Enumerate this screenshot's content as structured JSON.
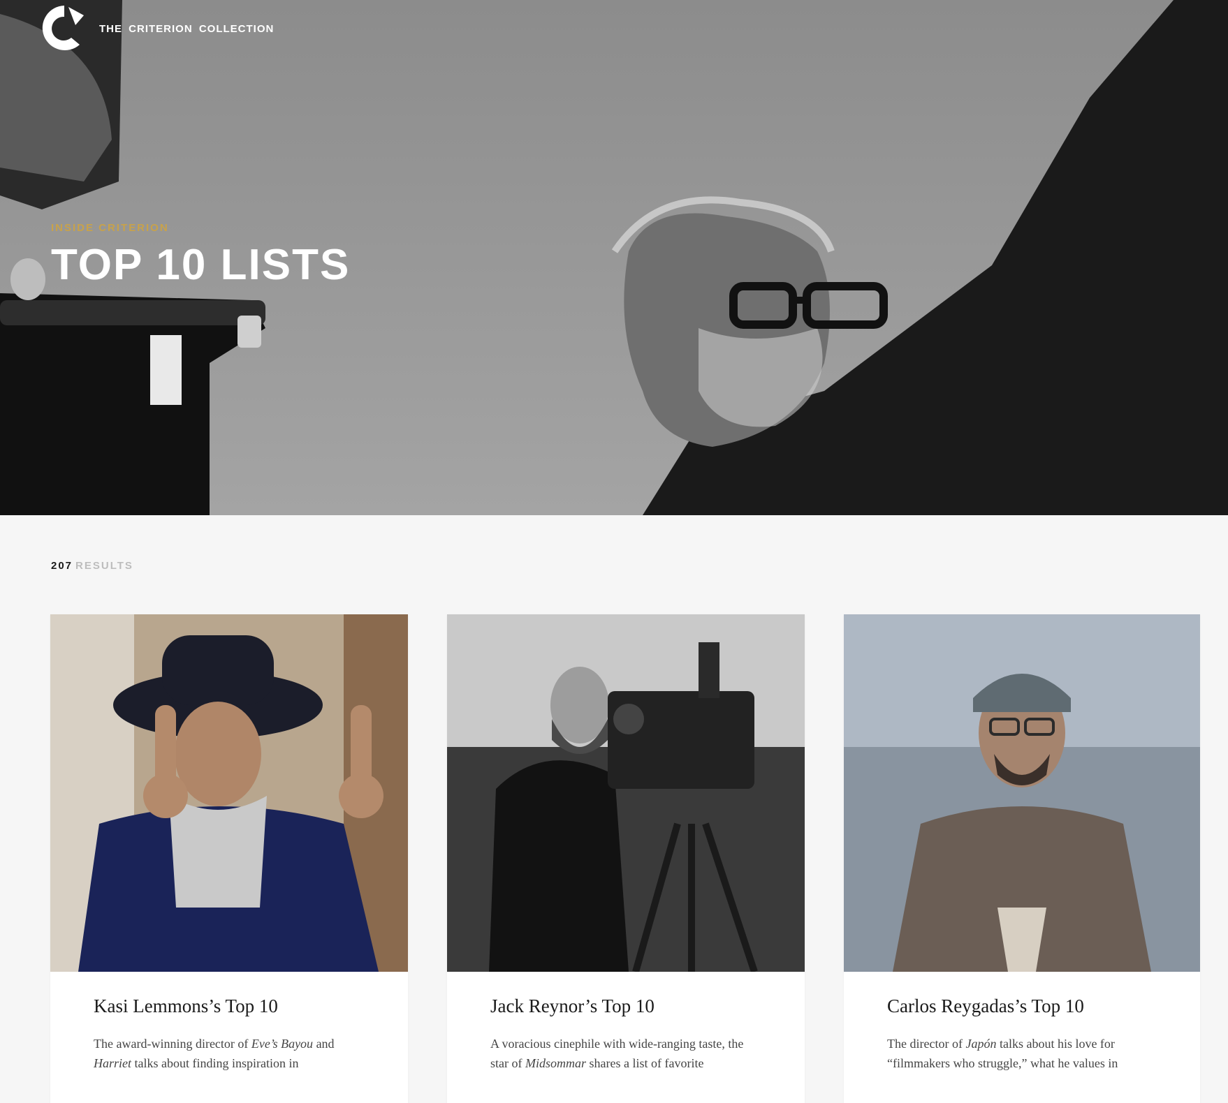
{
  "header": {
    "brand": "THE CRITERION COLLECTION"
  },
  "hero": {
    "eyebrow": "INSIDE CRITERION",
    "title": "TOP 10 LISTS"
  },
  "results": {
    "count": "207",
    "label": "RESULTS"
  },
  "cards": [
    {
      "title": "Kasi Lemmons’s Top 10",
      "desc": [
        {
          "text": "The award-winning director of ",
          "italic": false
        },
        {
          "text": "Eve’s Bayou",
          "italic": true
        },
        {
          "text": " and ",
          "italic": false
        },
        {
          "text": "Harriet",
          "italic": true
        },
        {
          "text": " talks about finding inspiration in",
          "italic": false
        }
      ]
    },
    {
      "title": "Jack Reynor’s Top 10",
      "desc": [
        {
          "text": "A voracious cinephile with wide-ranging taste, the star of ",
          "italic": false
        },
        {
          "text": "Midsommar",
          "italic": true
        },
        {
          "text": " shares a list of favorite",
          "italic": false
        }
      ]
    },
    {
      "title": "Carlos Reygadas’s Top 10",
      "desc": [
        {
          "text": "The director of ",
          "italic": false
        },
        {
          "text": "Japón",
          "italic": true
        },
        {
          "text": " talks about his love for “filmmakers who struggle,” what he values in",
          "italic": false
        }
      ]
    }
  ]
}
